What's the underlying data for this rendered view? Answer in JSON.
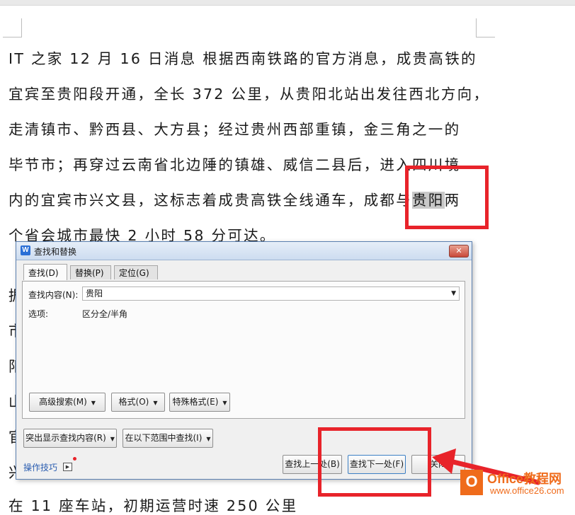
{
  "document": {
    "lines": [
      "IT 之家 12 月 16 日消息 根据西南铁路的官方消息，成贵高铁的",
      "宜宾至贵阳段开通，全长 372 公里，从贵阳北站出发往西北方向，",
      "走清镇市、黔西县、大方县；经过贵州西部重镇，金三角之一的",
      "毕节市；再穿过云南省北边陲的镇雄、威信二县后，进入四川境",
      "内的宜宾市兴文县，这标志着成贵高铁全线通车，成都与",
      "个省会城市最快 2 小时 58 分可达。"
    ],
    "highlight": "贵阳",
    "line5_tail": "两",
    "partial_left": [
      "据",
      "市",
      "阳",
      "山",
      "官",
      "兴"
    ],
    "bottom_line": "在 11 座车站，初期运营时速 250 公里"
  },
  "dialog": {
    "title": "查找和替换",
    "close_label": "✕",
    "app_icon_letter": "W",
    "tabs": [
      "查找(D)",
      "替换(P)",
      "定位(G)"
    ],
    "find_label": "查找内容(N):",
    "find_value": "贵阳",
    "options_label": "选项:",
    "options_value": "区分全/半角",
    "buttons": {
      "advanced": "高级搜索(M)",
      "format": "格式(O)",
      "special": "特殊格式(E)",
      "highlight": "突出显示查找内容(R)",
      "find_in": "在以下范围中查找(I)",
      "find_prev": "查找上一处(B)",
      "find_next": "查找下一处(F)",
      "close": "关闭"
    },
    "tips_link": "操作技巧"
  },
  "brand": {
    "logo_letter": "O",
    "name": "Office教程网",
    "url": "www.office26.com"
  },
  "colors": {
    "annotation_red": "#e8232a",
    "brand_orange": "#ef6b1b"
  }
}
